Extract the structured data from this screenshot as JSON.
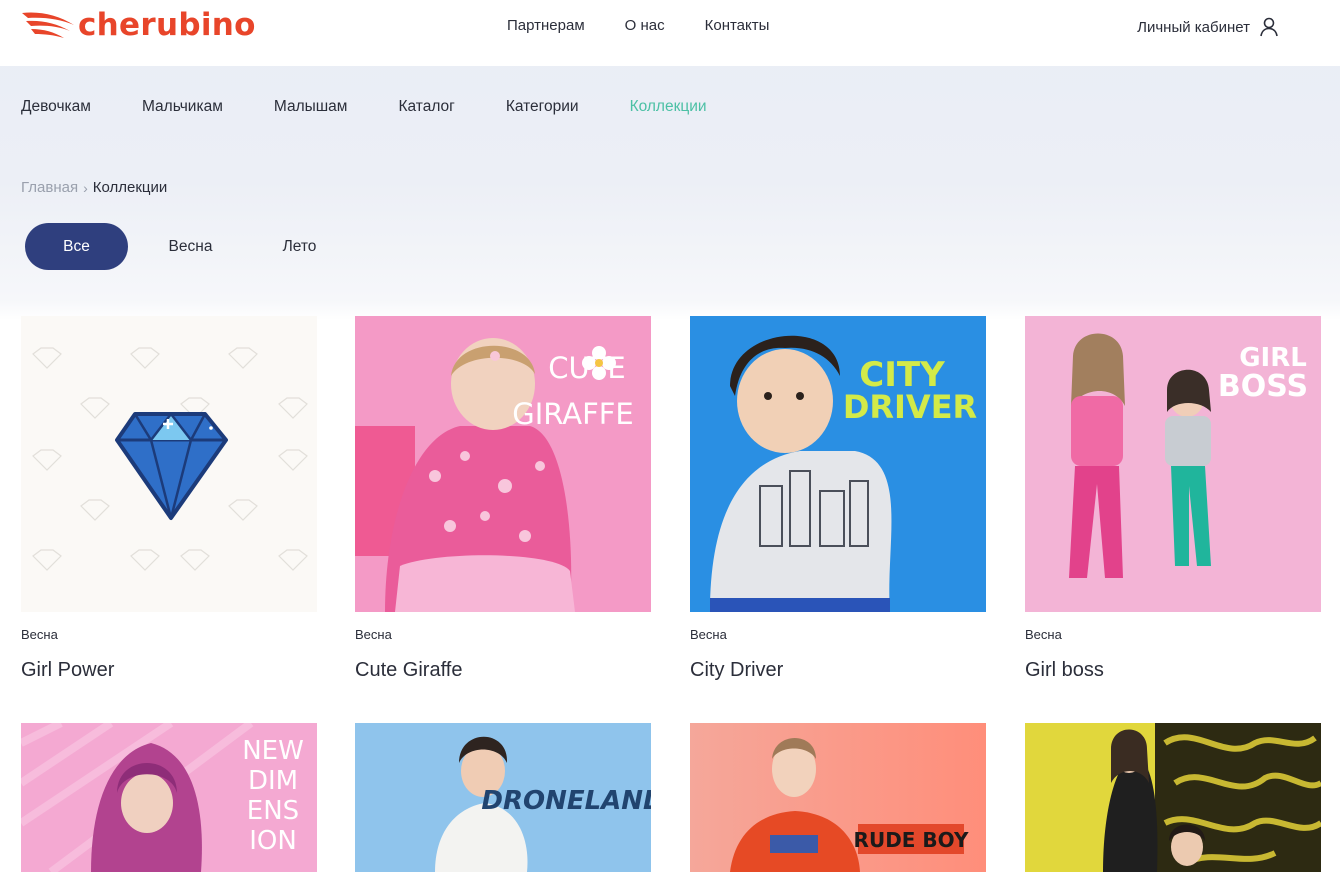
{
  "brand": {
    "name": "cherubino",
    "accent": "#e8452a"
  },
  "top_nav": {
    "items": [
      "Партнерам",
      "О нас",
      "Контакты"
    ],
    "account_label": "Личный кабинет",
    "account_icon": "user-icon"
  },
  "category_nav": {
    "items": [
      "Девочкам",
      "Мальчикам",
      "Малышам",
      "Каталог",
      "Категории",
      "Коллекции"
    ],
    "active": "Коллекции",
    "active_color": "#4cc0a5"
  },
  "breadcrumb": {
    "home": "Главная",
    "separator": "›",
    "current": "Коллекции"
  },
  "filters": {
    "items": [
      "Все",
      "Весна",
      "Лето"
    ],
    "active": "Все",
    "active_color": "#2f3f7e"
  },
  "collections": [
    {
      "season": "Весна",
      "title": "Girl Power"
    },
    {
      "season": "Весна",
      "title": "Cute Giraffe",
      "image_text": [
        "CUTE",
        "GIRAFFE"
      ]
    },
    {
      "season": "Весна",
      "title": "City Driver",
      "image_text": [
        "CITY",
        "DRIVER"
      ]
    },
    {
      "season": "Весна",
      "title": "Girl boss",
      "image_text": [
        "GIRL",
        "BOSS"
      ]
    },
    {
      "image_text": [
        "NEW",
        "DIM",
        "ENS",
        "ION"
      ]
    },
    {
      "image_text": [
        "DRONELAND"
      ]
    },
    {
      "image_text": [
        "RUDE BOY"
      ]
    },
    {}
  ]
}
